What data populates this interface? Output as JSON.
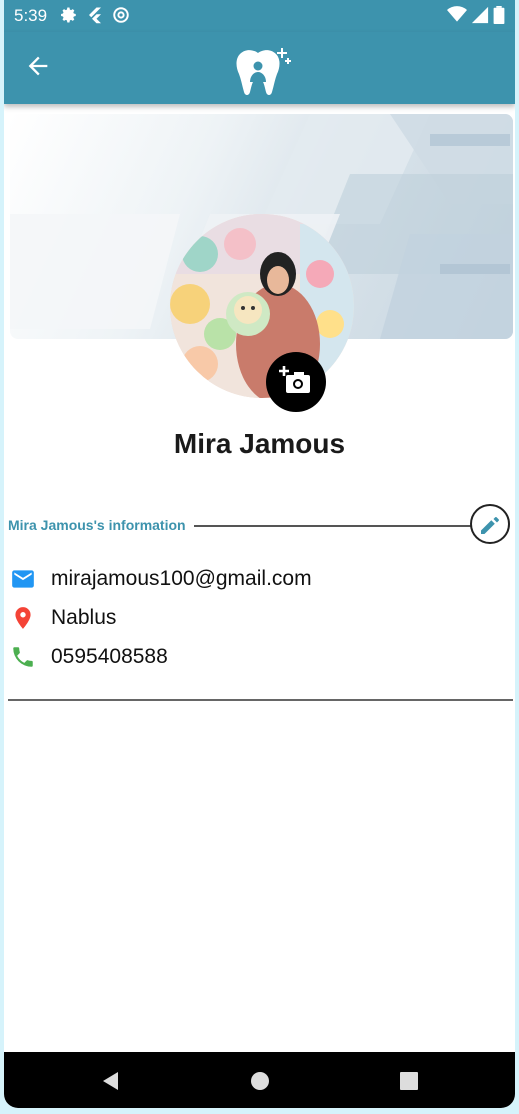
{
  "status_bar": {
    "time": "5:39",
    "left_icons": [
      "gear-icon",
      "flutter-icon",
      "at-sign-icon"
    ],
    "right_icons": [
      "wifi-icon",
      "signal-icon",
      "battery-icon"
    ]
  },
  "app_bar": {
    "back_icon": "arrow-left-icon",
    "logo_icon": "tooth-person-logo",
    "background_color": "#3d93ad"
  },
  "profile": {
    "name": "Mira Jamous",
    "camera_icon": "add-photo-camera-icon"
  },
  "info_section": {
    "title": "Mira Jamous's information",
    "edit_icon": "pencil-icon",
    "title_color": "#3d93ad",
    "items": [
      {
        "icon": "email-icon",
        "color": "#2196f3",
        "text": "mirajamous100@gmail.com"
      },
      {
        "icon": "location-pin-icon",
        "color": "#f44336",
        "text": "Nablus"
      },
      {
        "icon": "phone-icon",
        "color": "#4caf50",
        "text": "0595408588"
      }
    ]
  },
  "nav_bar": {
    "buttons": [
      "back-triangle-icon",
      "home-circle-icon",
      "recents-square-icon"
    ]
  }
}
